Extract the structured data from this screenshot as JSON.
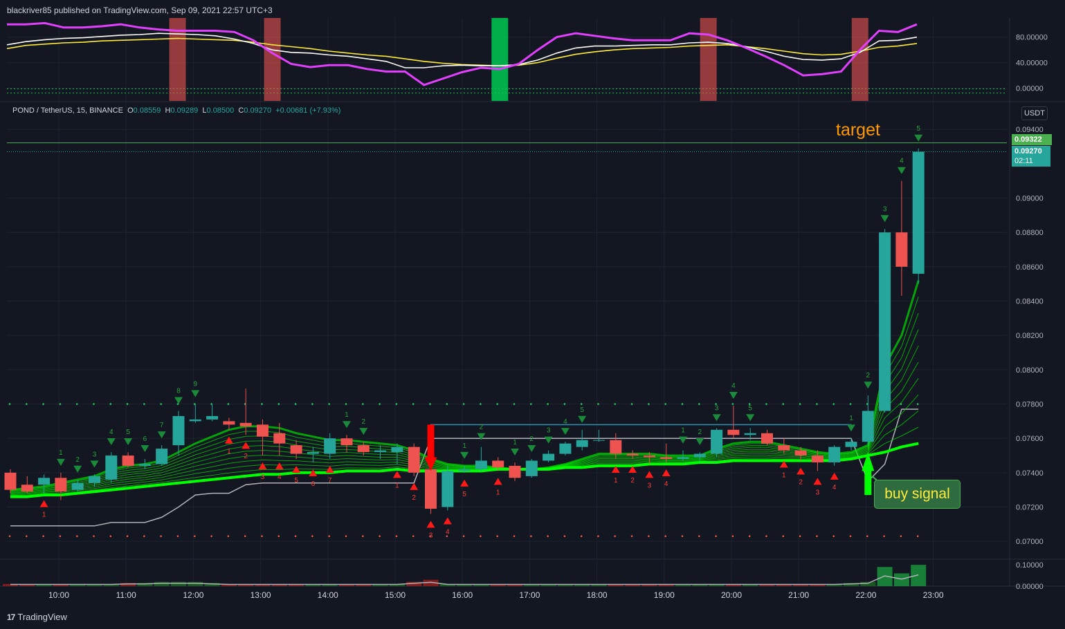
{
  "header": {
    "publish_line": "blackriver85 published on TradingView.com, Sep 09, 2021 22:57 UTC+3"
  },
  "footer": {
    "brand": "TradingView"
  },
  "legend": {
    "symbol": "POND / TetherUS, 15, BINANCE",
    "o_label": "O",
    "o": "0.08559",
    "h_label": "H",
    "h": "0.09289",
    "l_label": "L",
    "l": "0.08500",
    "c_label": "C",
    "c": "0.09270",
    "change": "+0.00681 (+7.93%)"
  },
  "unit_button": "USDT",
  "badges": {
    "target_price": "0.09322",
    "last_price": "0.09270",
    "countdown": "02:11"
  },
  "annotations": {
    "target": "target",
    "buy_signal": "buy signal"
  },
  "colors": {
    "background": "#131722",
    "up": "#26a69a",
    "down": "#ef5350",
    "ribbon": "#00e000",
    "stoch_k": "#e040fb",
    "stoch_d": "#ffeb3b",
    "stoch_w": "#ffffff",
    "target": "#ff9800",
    "buy_box": "#2e6b3f"
  },
  "chart_data": [
    {
      "type": "line",
      "name": "oscillator",
      "ylim": [
        -20,
        110
      ],
      "y_ticks": [
        "80.00000",
        "40.00000",
        "0.00000"
      ],
      "y_tick_values": [
        80,
        40,
        0
      ],
      "series": [
        {
          "color": "#e040fb",
          "values": [
            100,
            100,
            102,
            95,
            95,
            97,
            100,
            95,
            92,
            90,
            90,
            90,
            88,
            75,
            55,
            38,
            33,
            36,
            36,
            30,
            26,
            26,
            5,
            15,
            25,
            32,
            30,
            38,
            60,
            80,
            86,
            82,
            78,
            75,
            75,
            75,
            86,
            84,
            75,
            63,
            50,
            36,
            20,
            22,
            26,
            60,
            90,
            88,
            100
          ]
        },
        {
          "color": "#ffffff",
          "values": [
            68,
            73,
            76,
            78,
            79,
            81,
            83,
            84,
            86,
            85,
            84,
            82,
            77,
            70,
            60,
            56,
            55,
            52,
            50,
            46,
            42,
            32,
            32,
            35,
            36,
            35,
            35,
            37,
            44,
            55,
            63,
            66,
            66,
            67,
            68,
            68,
            71,
            72,
            70,
            65,
            58,
            50,
            45,
            44,
            46,
            56,
            74,
            75,
            80
          ]
        },
        {
          "color": "#ffeb3b",
          "values": [
            62,
            67,
            69,
            71,
            72,
            74,
            75,
            76,
            77,
            78,
            77,
            76,
            75,
            72,
            68,
            65,
            62,
            58,
            55,
            52,
            50,
            46,
            42,
            39,
            37,
            36,
            35,
            36,
            40,
            47,
            53,
            57,
            60,
            62,
            63,
            64,
            66,
            67,
            68,
            65,
            62,
            58,
            54,
            52,
            53,
            58,
            64,
            66,
            70
          ]
        }
      ],
      "bands": [
        {
          "index": 9,
          "color": "#ef5350"
        },
        {
          "index": 14,
          "color": "#ef5350"
        },
        {
          "index": 26,
          "color": "#00c853"
        },
        {
          "index": 37,
          "color": "#ef5350"
        },
        {
          "index": 45,
          "color": "#ef5350"
        }
      ]
    },
    {
      "type": "candlestick",
      "name": "price",
      "ylim": [
        0.069,
        0.0955
      ],
      "y_ticks": [
        "0.09400",
        "0.09000",
        "0.08800",
        "0.08600",
        "0.08400",
        "0.08200",
        "0.08000",
        "0.07800",
        "0.07600",
        "0.07400",
        "0.07200",
        "0.07000"
      ],
      "y_tick_values": [
        0.094,
        0.09,
        0.088,
        0.086,
        0.084,
        0.082,
        0.08,
        0.078,
        0.076,
        0.074,
        0.072,
        0.07
      ],
      "x_ticks": [
        "10:00",
        "11:00",
        "12:00",
        "13:00",
        "14:00",
        "15:00",
        "16:00",
        "17:00",
        "18:00",
        "19:00",
        "20:00",
        "21:00",
        "22:00",
        "23:00"
      ],
      "candles": [
        {
          "o": 0.074,
          "h": 0.0742,
          "l": 0.0728,
          "c": 0.073
        },
        {
          "o": 0.0733,
          "h": 0.0738,
          "l": 0.0728,
          "c": 0.0729
        },
        {
          "o": 0.0733,
          "h": 0.0739,
          "l": 0.0728,
          "c": 0.0737
        },
        {
          "o": 0.0737,
          "h": 0.074,
          "l": 0.0724,
          "c": 0.0729
        },
        {
          "o": 0.073,
          "h": 0.0736,
          "l": 0.0729,
          "c": 0.0734
        },
        {
          "o": 0.0734,
          "h": 0.0739,
          "l": 0.0732,
          "c": 0.0738
        },
        {
          "o": 0.0736,
          "h": 0.0752,
          "l": 0.0734,
          "c": 0.075
        },
        {
          "o": 0.075,
          "h": 0.0752,
          "l": 0.0743,
          "c": 0.0744
        },
        {
          "o": 0.0744,
          "h": 0.0748,
          "l": 0.0742,
          "c": 0.0745
        },
        {
          "o": 0.0745,
          "h": 0.0756,
          "l": 0.0744,
          "c": 0.0754
        },
        {
          "o": 0.0756,
          "h": 0.0776,
          "l": 0.075,
          "c": 0.0773
        },
        {
          "o": 0.077,
          "h": 0.078,
          "l": 0.0769,
          "c": 0.0771
        },
        {
          "o": 0.0771,
          "h": 0.078,
          "l": 0.077,
          "c": 0.0773
        },
        {
          "o": 0.077,
          "h": 0.0772,
          "l": 0.0765,
          "c": 0.0768
        },
        {
          "o": 0.0769,
          "h": 0.0789,
          "l": 0.0762,
          "c": 0.0767
        },
        {
          "o": 0.0768,
          "h": 0.0771,
          "l": 0.075,
          "c": 0.0761
        },
        {
          "o": 0.0763,
          "h": 0.0769,
          "l": 0.075,
          "c": 0.0757
        },
        {
          "o": 0.0756,
          "h": 0.0759,
          "l": 0.0748,
          "c": 0.0751
        },
        {
          "o": 0.0751,
          "h": 0.0755,
          "l": 0.0746,
          "c": 0.0752
        },
        {
          "o": 0.0751,
          "h": 0.0763,
          "l": 0.0748,
          "c": 0.076
        },
        {
          "o": 0.076,
          "h": 0.0762,
          "l": 0.0752,
          "c": 0.0756
        },
        {
          "o": 0.0756,
          "h": 0.0758,
          "l": 0.075,
          "c": 0.0752
        },
        {
          "o": 0.0752,
          "h": 0.0756,
          "l": 0.0748,
          "c": 0.0753
        },
        {
          "o": 0.0752,
          "h": 0.0757,
          "l": 0.0745,
          "c": 0.0755
        },
        {
          "o": 0.0755,
          "h": 0.0757,
          "l": 0.0738,
          "c": 0.074
        },
        {
          "o": 0.0742,
          "h": 0.0745,
          "l": 0.0716,
          "c": 0.0719
        },
        {
          "o": 0.072,
          "h": 0.0744,
          "l": 0.0718,
          "c": 0.0741
        },
        {
          "o": 0.0741,
          "h": 0.0744,
          "l": 0.074,
          "c": 0.0742
        },
        {
          "o": 0.0742,
          "h": 0.0755,
          "l": 0.0741,
          "c": 0.0747
        },
        {
          "o": 0.0747,
          "h": 0.0749,
          "l": 0.0741,
          "c": 0.0743
        },
        {
          "o": 0.0744,
          "h": 0.0746,
          "l": 0.0735,
          "c": 0.0737
        },
        {
          "o": 0.0738,
          "h": 0.0748,
          "l": 0.0737,
          "c": 0.0747
        },
        {
          "o": 0.0747,
          "h": 0.0753,
          "l": 0.0746,
          "c": 0.0751
        },
        {
          "o": 0.0751,
          "h": 0.0758,
          "l": 0.075,
          "c": 0.0757
        },
        {
          "o": 0.0755,
          "h": 0.0765,
          "l": 0.0753,
          "c": 0.0759
        },
        {
          "o": 0.0759,
          "h": 0.0765,
          "l": 0.0758,
          "c": 0.0759
        },
        {
          "o": 0.0759,
          "h": 0.0763,
          "l": 0.0748,
          "c": 0.0751
        },
        {
          "o": 0.0751,
          "h": 0.0753,
          "l": 0.0748,
          "c": 0.075
        },
        {
          "o": 0.075,
          "h": 0.0752,
          "l": 0.0745,
          "c": 0.0749
        },
        {
          "o": 0.0749,
          "h": 0.0757,
          "l": 0.0746,
          "c": 0.0748
        },
        {
          "o": 0.0748,
          "h": 0.0753,
          "l": 0.0747,
          "c": 0.0749
        },
        {
          "o": 0.0749,
          "h": 0.0752,
          "l": 0.0747,
          "c": 0.0751
        },
        {
          "o": 0.0751,
          "h": 0.0766,
          "l": 0.0749,
          "c": 0.0765
        },
        {
          "o": 0.0765,
          "h": 0.0779,
          "l": 0.076,
          "c": 0.0762
        },
        {
          "o": 0.0762,
          "h": 0.0766,
          "l": 0.0759,
          "c": 0.0763
        },
        {
          "o": 0.0763,
          "h": 0.0765,
          "l": 0.0756,
          "c": 0.0757
        },
        {
          "o": 0.0756,
          "h": 0.076,
          "l": 0.0751,
          "c": 0.0753
        },
        {
          "o": 0.0753,
          "h": 0.0755,
          "l": 0.0747,
          "c": 0.075
        },
        {
          "o": 0.075,
          "h": 0.0753,
          "l": 0.0741,
          "c": 0.0746
        },
        {
          "o": 0.0746,
          "h": 0.0756,
          "l": 0.0744,
          "c": 0.0755
        },
        {
          "o": 0.0755,
          "h": 0.076,
          "l": 0.0753,
          "c": 0.0758
        },
        {
          "o": 0.0758,
          "h": 0.0785,
          "l": 0.0756,
          "c": 0.0776
        },
        {
          "o": 0.0776,
          "h": 0.0882,
          "l": 0.0775,
          "c": 0.088
        },
        {
          "o": 0.088,
          "h": 0.091,
          "l": 0.0843,
          "c": 0.086
        },
        {
          "o": 0.08559,
          "h": 0.09289,
          "l": 0.085,
          "c": 0.0927
        }
      ],
      "ribbon_top": [
        0.073,
        0.0731,
        0.0732,
        0.0734,
        0.0736,
        0.0738,
        0.0742,
        0.0744,
        0.0745,
        0.0747,
        0.0752,
        0.0757,
        0.0761,
        0.0765,
        0.0767,
        0.0767,
        0.0766,
        0.0763,
        0.0761,
        0.0759,
        0.0759,
        0.0758,
        0.0757,
        0.0756,
        0.0753,
        0.0748,
        0.0745,
        0.0744,
        0.0744,
        0.0743,
        0.0742,
        0.0742,
        0.0743,
        0.0745,
        0.0748,
        0.0751,
        0.0751,
        0.0751,
        0.0751,
        0.075,
        0.075,
        0.075,
        0.0754,
        0.0757,
        0.0758,
        0.0758,
        0.0756,
        0.0754,
        0.0752,
        0.0751,
        0.0752,
        0.0756,
        0.0802,
        0.082,
        0.0852
      ],
      "ribbon_bottom": [
        0.0726,
        0.0726,
        0.0727,
        0.0727,
        0.0728,
        0.0729,
        0.073,
        0.0731,
        0.0732,
        0.0733,
        0.0734,
        0.0735,
        0.0736,
        0.0737,
        0.0738,
        0.0739,
        0.0739,
        0.074,
        0.074,
        0.074,
        0.0741,
        0.0741,
        0.0741,
        0.0742,
        0.0741,
        0.0741,
        0.0741,
        0.0741,
        0.0741,
        0.0742,
        0.0742,
        0.0742,
        0.0742,
        0.0743,
        0.0743,
        0.0744,
        0.0744,
        0.0744,
        0.0745,
        0.0745,
        0.0745,
        0.0746,
        0.0746,
        0.0747,
        0.0747,
        0.0747,
        0.0747,
        0.0747,
        0.0747,
        0.0747,
        0.0748,
        0.075,
        0.0752,
        0.0755,
        0.0757
      ],
      "gray_line": [
        0.0709,
        0.0709,
        0.0709,
        0.0709,
        0.0709,
        0.0709,
        0.0711,
        0.0711,
        0.0711,
        0.0714,
        0.072,
        0.0727,
        0.0728,
        0.0728,
        0.0733,
        0.0734,
        0.0734,
        0.0734,
        0.0734,
        0.0734,
        0.0734,
        0.0734,
        0.0734,
        0.0734,
        0.0734,
        0.076,
        0.076,
        0.076,
        0.076,
        0.076,
        0.076,
        0.076,
        0.076,
        0.076,
        0.076,
        0.076,
        0.076,
        0.076,
        0.076,
        0.076,
        0.076,
        0.076,
        0.076,
        0.076,
        0.076,
        0.076,
        0.076,
        0.076,
        0.076,
        0.076,
        0.076,
        0.0735,
        0.0745,
        0.0777,
        0.0777
      ],
      "resistance_level": 0.0768,
      "dotted_upper": 0.078,
      "dotted_lower": 0.0703,
      "target_level": 0.09322,
      "sell_markers": [
        {
          "i": 4,
          "label": "1"
        },
        {
          "i": 5,
          "label": "2"
        },
        {
          "i": 6,
          "label": "3"
        },
        {
          "i": 7,
          "label": "4"
        },
        {
          "i": 8,
          "label": "5"
        },
        {
          "i": 9,
          "label": "6"
        },
        {
          "i": 10,
          "label": "7"
        },
        {
          "i": 11,
          "label": "8"
        },
        {
          "i": 12,
          "label": "9"
        },
        {
          "i": 21,
          "label": "1"
        },
        {
          "i": 22,
          "label": "2"
        },
        {
          "i": 28,
          "label": "1"
        },
        {
          "i": 29,
          "label": "2"
        },
        {
          "i": 31,
          "label": "1"
        },
        {
          "i": 32,
          "label": "2"
        },
        {
          "i": 33,
          "label": "3"
        },
        {
          "i": 34,
          "label": "4"
        },
        {
          "i": 35,
          "label": "5"
        },
        {
          "i": 41,
          "label": "1"
        },
        {
          "i": 42,
          "label": "2"
        },
        {
          "i": 43,
          "label": "3"
        },
        {
          "i": 44,
          "label": "4"
        },
        {
          "i": 45,
          "label": "5"
        },
        {
          "i": 51,
          "label": "1"
        },
        {
          "i": 52,
          "label": "2"
        },
        {
          "i": 53,
          "label": "3"
        },
        {
          "i": 54,
          "label": "4"
        },
        {
          "i": 55,
          "label": "5"
        }
      ],
      "buy_markers": [
        {
          "i": 3,
          "label": "1"
        },
        {
          "i": 14,
          "label": "1"
        },
        {
          "i": 15,
          "label": "2"
        },
        {
          "i": 16,
          "label": "3"
        },
        {
          "i": 17,
          "label": "4"
        },
        {
          "i": 18,
          "label": "5"
        },
        {
          "i": 19,
          "label": "6"
        },
        {
          "i": 20,
          "label": "7"
        },
        {
          "i": 24,
          "label": "1"
        },
        {
          "i": 25,
          "label": "2"
        },
        {
          "i": 26,
          "label": "3"
        },
        {
          "i": 27,
          "label": "4"
        },
        {
          "i": 28,
          "label": "5"
        },
        {
          "i": 30,
          "label": "1"
        },
        {
          "i": 37,
          "label": "1"
        },
        {
          "i": 38,
          "label": "2"
        },
        {
          "i": 39,
          "label": "3"
        },
        {
          "i": 40,
          "label": "4"
        },
        {
          "i": 47,
          "label": "1"
        },
        {
          "i": 48,
          "label": "2"
        },
        {
          "i": 49,
          "label": "3"
        },
        {
          "i": 50,
          "label": "4"
        }
      ]
    },
    {
      "type": "bar",
      "name": "volume",
      "ylim": [
        0,
        0.12
      ],
      "y_ticks": [
        "0.10000",
        "0.00000"
      ],
      "y_tick_values": [
        0.1,
        0
      ],
      "values": [
        0.01,
        0.01,
        0.01,
        0.01,
        0.01,
        0.01,
        0.01,
        0.015,
        0.015,
        0.02,
        0.02,
        0.02,
        0.015,
        0.01,
        0.01,
        0.01,
        0.01,
        0.01,
        0.01,
        0.01,
        0.01,
        0.01,
        0.01,
        0.01,
        0.02,
        0.03,
        0.01,
        0.01,
        0.01,
        0.01,
        0.01,
        0.01,
        0.01,
        0.01,
        0.01,
        0.01,
        0.01,
        0.01,
        0.01,
        0.01,
        0.01,
        0.01,
        0.01,
        0.01,
        0.01,
        0.01,
        0.01,
        0.01,
        0.01,
        0.01,
        0.015,
        0.02,
        0.09,
        0.06,
        0.1
      ]
    }
  ]
}
